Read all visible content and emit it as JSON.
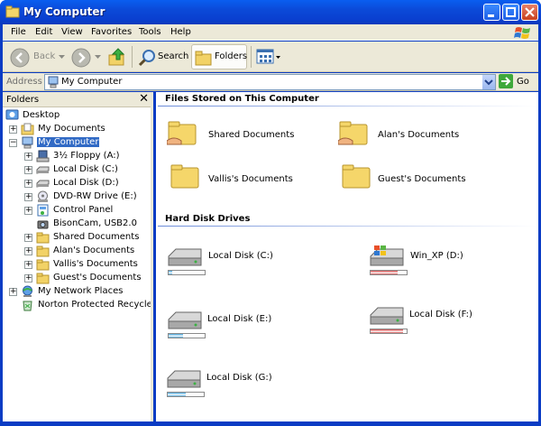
{
  "window": {
    "title": "My Computer"
  },
  "menu": [
    "File",
    "Edit",
    "View",
    "Favorites",
    "Tools",
    "Help"
  ],
  "toolbar": {
    "back_label": "Back",
    "search_label": "Search",
    "folders_label": "Folders"
  },
  "address": {
    "label": "Address",
    "value": "My Computer",
    "go_label": "Go"
  },
  "folders_pane": {
    "title": "Folders",
    "close_glyph": "✕",
    "tree": [
      {
        "label": "Desktop",
        "icon": "desktop-icon"
      },
      {
        "label": "My Documents",
        "icon": "my-documents-icon"
      },
      {
        "label": "My Computer",
        "icon": "my-computer-icon"
      },
      {
        "label": "3½ Floppy (A:)",
        "icon": "floppy-icon"
      },
      {
        "label": "Local Disk (C:)",
        "icon": "hard-disk-icon"
      },
      {
        "label": "Local Disk (D:)",
        "icon": "hard-disk-icon"
      },
      {
        "label": "DVD-RW Drive (E:)",
        "icon": "dvd-drive-icon"
      },
      {
        "label": "Control Panel",
        "icon": "control-panel-icon"
      },
      {
        "label": "BisonCam, USB2.0",
        "icon": "camera-icon"
      },
      {
        "label": "Shared Documents",
        "icon": "folder-icon"
      },
      {
        "label": "Alan's Documents",
        "icon": "folder-icon"
      },
      {
        "label": "Vallis's Documents",
        "icon": "folder-icon"
      },
      {
        "label": "Guest's Documents",
        "icon": "folder-icon"
      },
      {
        "label": "My Network Places",
        "icon": "network-places-icon"
      },
      {
        "label": "Norton Protected Recycle Bin",
        "icon": "recycle-bin-icon"
      }
    ]
  },
  "content": {
    "files_group": "Files Stored on This Computer",
    "files": [
      "Shared Documents",
      "Alan's Documents",
      "Vallis's Documents",
      "Guest's Documents"
    ],
    "drives_group": "Hard Disk Drives",
    "drives": [
      {
        "label": "Local Disk (C:)",
        "used_fraction": 0.1,
        "color": "#3fa0d8"
      },
      {
        "label": "Win_XP (D:)",
        "used_fraction": 0.75,
        "color": "#d04040"
      },
      {
        "label": "Local Disk (E:)",
        "used_fraction": 0.4,
        "color": "#3fa0d8"
      },
      {
        "label": "Local Disk (F:)",
        "used_fraction": 0.9,
        "color": "#d04040"
      },
      {
        "label": "Local Disk (G:)",
        "used_fraction": 0.5,
        "color": "#3fa0d8"
      }
    ]
  }
}
